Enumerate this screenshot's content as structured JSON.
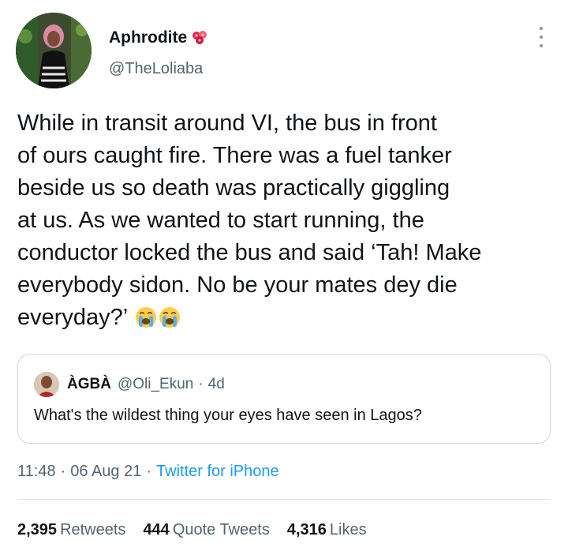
{
  "user": {
    "display_name": "Aphrodite",
    "name_emoji": "flowers-emoji",
    "handle": "@TheLoliaba"
  },
  "tweet": {
    "lines": [
      "While in transit around VI, the bus in front",
      "of ours caught fire. There was a fuel tanker",
      "beside us so death was practically giggling",
      "at us. As we wanted to start running, the",
      "conductor locked the bus and said ‘Tah! Make",
      "everybody sidon. No be your mates dey die",
      "everyday?’"
    ],
    "trailing_emoji": "loudly-crying-face-emoji"
  },
  "quote": {
    "name": "ÀGBÀ",
    "handle": "@Oli_Ekun",
    "time": "4d",
    "separator": "·",
    "text": "What's the wildest thing your eyes have seen in Lagos?"
  },
  "meta": {
    "time": "11:48",
    "date": "06 Aug 21",
    "separator": "·",
    "source": "Twitter for iPhone"
  },
  "stats": {
    "retweets_count": "2,395",
    "retweets_label": "Retweets",
    "quotes_count": "444",
    "quotes_label": "Quote Tweets",
    "likes_count": "4,316",
    "likes_label": "Likes"
  },
  "colors": {
    "accent": "#1d9bf0",
    "secondary_text": "#536471",
    "border": "#cfd9de"
  }
}
